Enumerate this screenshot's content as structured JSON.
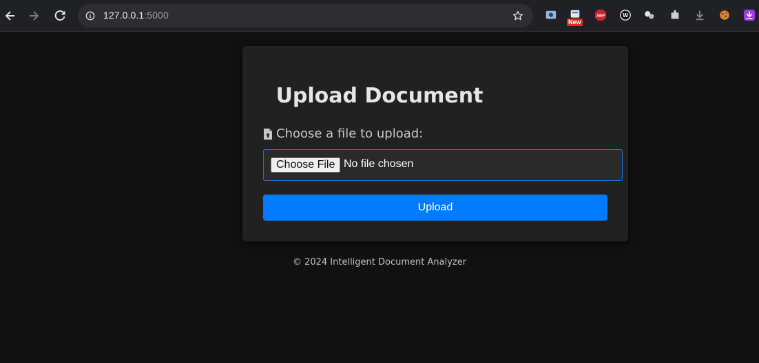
{
  "browser": {
    "url_host": "127.0.0.1",
    "url_port": ":5000",
    "extension_badge": "New"
  },
  "page": {
    "title": "Upload Document",
    "file_label": "Choose a file to upload:",
    "choose_button_label": "Choose File",
    "no_file_text": "No file chosen",
    "upload_button_label": "Upload",
    "footer_text": "© 2024 Intelligent Document Analyzer"
  },
  "icons": {
    "back": "arrow-left-icon",
    "forward": "arrow-right-icon",
    "reload": "reload-icon",
    "site_info": "info-icon",
    "bookmark": "star-icon",
    "file_upload": "file-upload-icon"
  },
  "colors": {
    "page_background": "#111111",
    "card_background": "#212121",
    "accent": "#007bff",
    "focus_border": "#1f6fd6"
  }
}
